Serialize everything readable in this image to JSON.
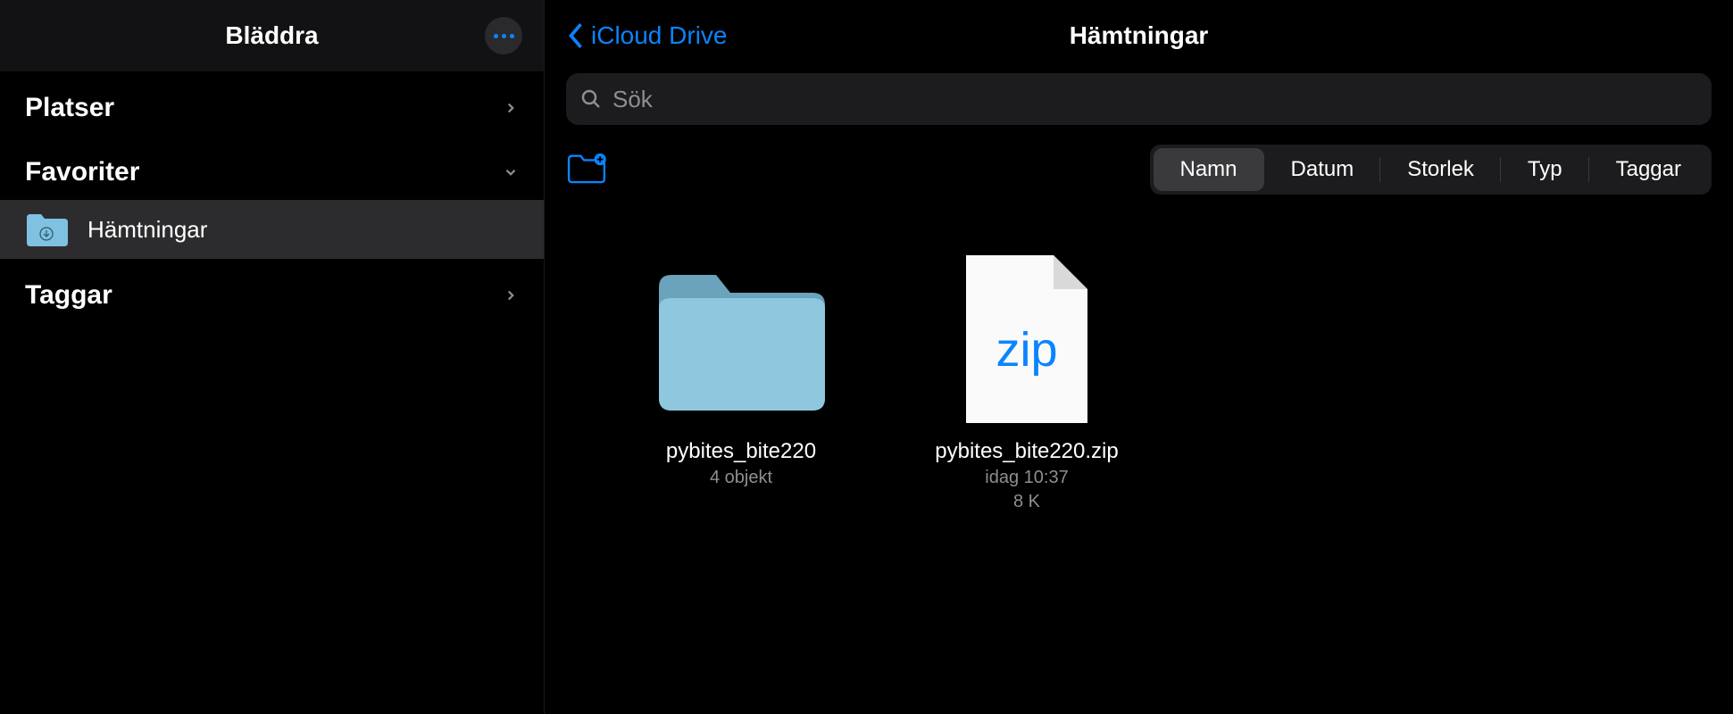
{
  "sidebar": {
    "title": "Bläddra",
    "sections": {
      "places": {
        "label": "Platser"
      },
      "favorites": {
        "label": "Favoriter",
        "items": [
          {
            "label": "Hämtningar"
          }
        ]
      },
      "tags": {
        "label": "Taggar"
      }
    }
  },
  "main": {
    "back_label": "iCloud Drive",
    "title": "Hämtningar",
    "search_placeholder": "Sök",
    "sort": {
      "tabs": [
        "Namn",
        "Datum",
        "Storlek",
        "Typ",
        "Taggar"
      ],
      "active_index": 0
    },
    "items": [
      {
        "type": "folder",
        "name": "pybites_bite220",
        "meta1": "4 objekt",
        "meta2": ""
      },
      {
        "type": "zip",
        "name": "pybites_bite220.zip",
        "meta1": "idag 10:37",
        "meta2": "8 K"
      }
    ]
  }
}
